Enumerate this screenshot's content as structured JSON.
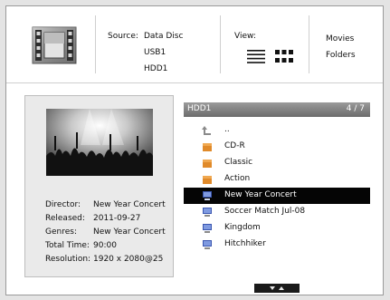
{
  "header": {
    "source_label": "Source:",
    "sources": [
      "Data Disc",
      "USB1",
      "HDD1"
    ],
    "view_label": "View:",
    "modes": [
      "Movies",
      "Folders"
    ]
  },
  "info": {
    "fields": [
      {
        "key": "Director:",
        "value": "New Year Concert"
      },
      {
        "key": "Released:",
        "value": "2011-09-27"
      },
      {
        "key": "Genres:",
        "value": "New Year Concert"
      },
      {
        "key": "Total Time:",
        "value": "90:00"
      },
      {
        "key": "Resolution:",
        "value": "1920 x 2080@25"
      }
    ]
  },
  "list": {
    "path": "HDD1",
    "count": "4 / 7",
    "items": [
      {
        "label": "..",
        "icon": "back-arrow-icon"
      },
      {
        "label": "CD-R",
        "icon": "folder-icon"
      },
      {
        "label": "Classic",
        "icon": "folder-icon"
      },
      {
        "label": "Action",
        "icon": "folder-icon"
      },
      {
        "label": "New Year Concert",
        "icon": "video-file-icon",
        "selected": true
      },
      {
        "label": "Soccer Match Jul-08",
        "icon": "video-file-icon"
      },
      {
        "label": "Kingdom",
        "icon": "video-file-icon"
      },
      {
        "label": "Hitchhiker",
        "icon": "video-file-icon"
      }
    ]
  },
  "colors": {
    "selected_row": "#050505",
    "folder": "#e08a2a",
    "video_icon": "#3a56b0",
    "header_bar": "#7a7a7a"
  }
}
